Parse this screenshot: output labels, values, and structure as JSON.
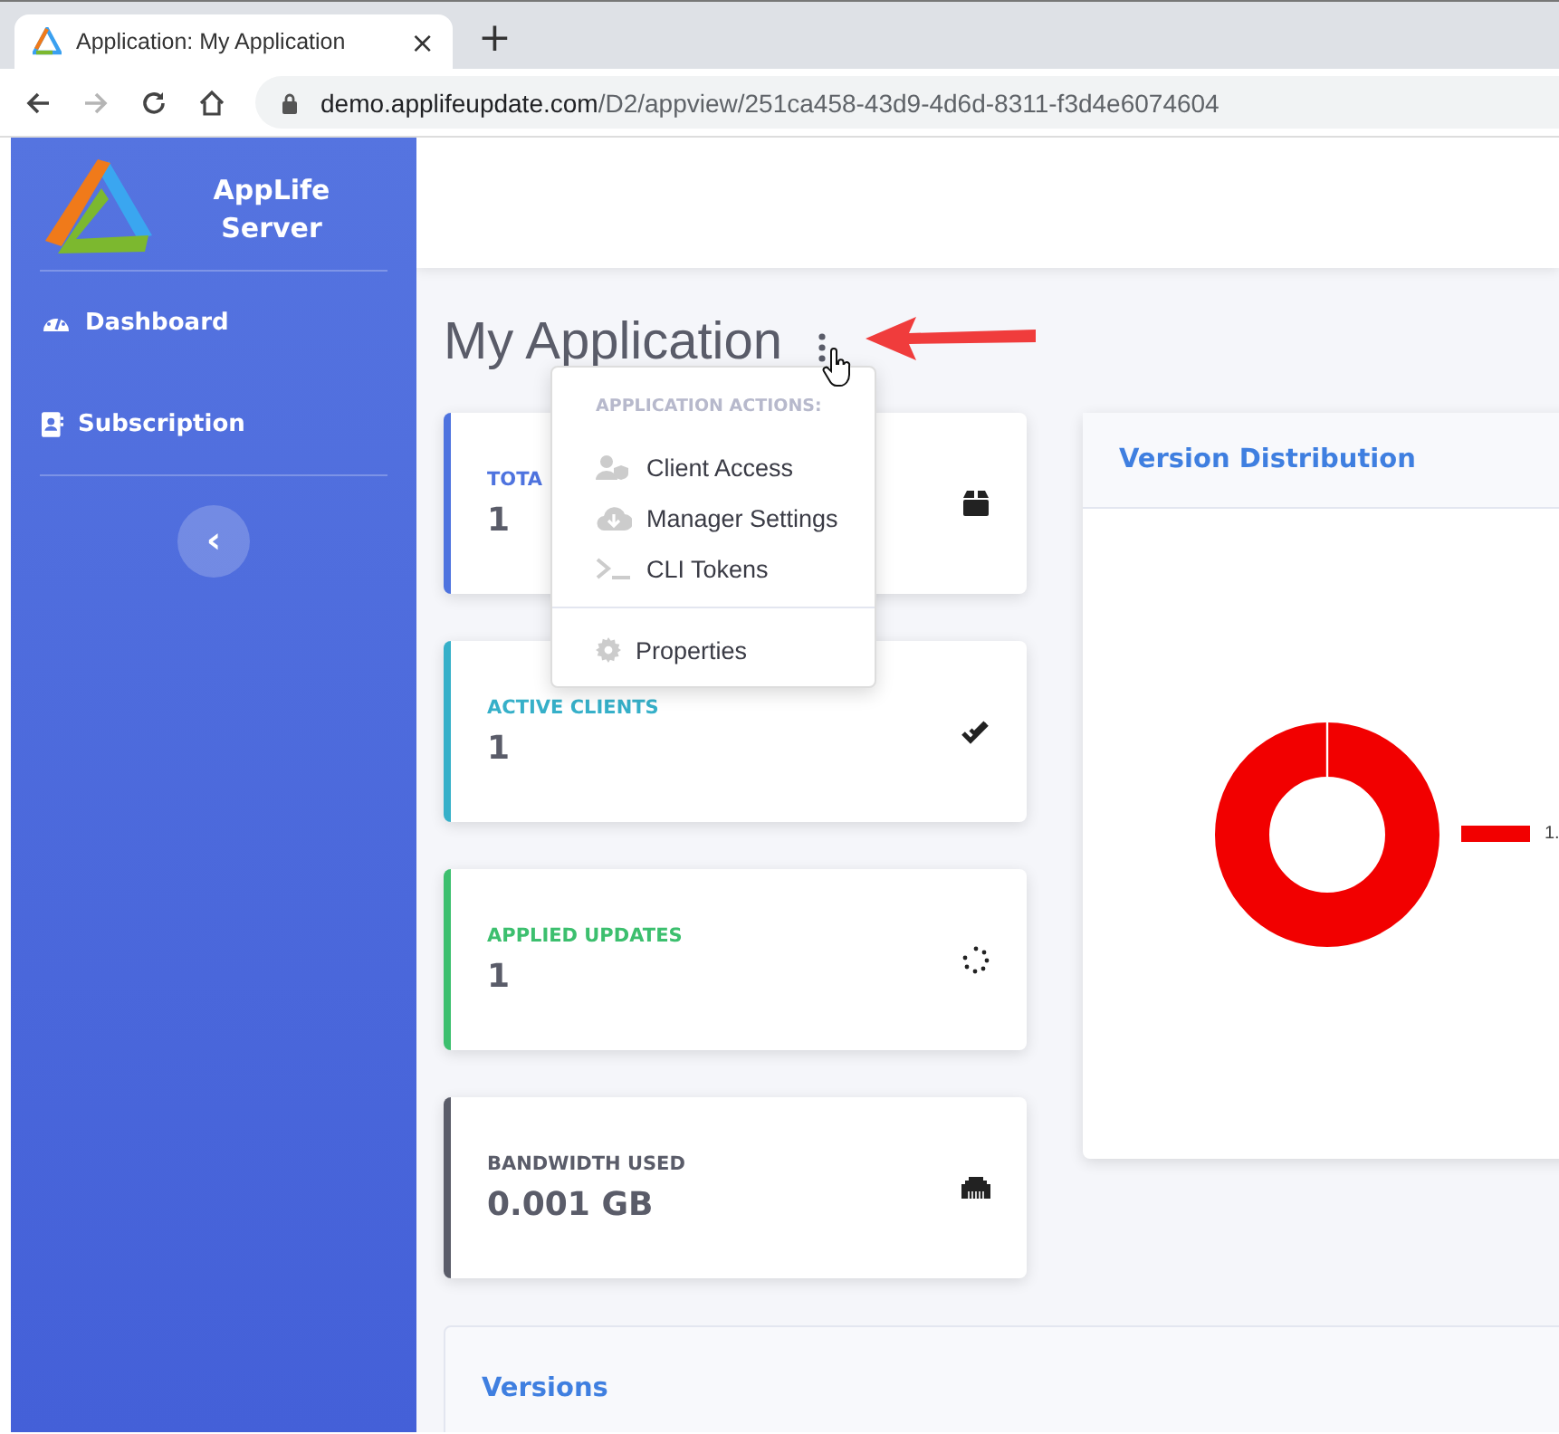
{
  "browser": {
    "tab": {
      "title": "Application: My Application",
      "close": "×"
    },
    "new_tab": "+",
    "forward": {
      "disabled": true
    },
    "url_host": "demo.applifeupdate.com",
    "url_path": "/D2/appview/251ca458-43d9-4d6d-8311-f3d4e6074604"
  },
  "sidebar": {
    "brand": [
      "AppLife",
      "Server"
    ],
    "items": [
      {
        "label": "Dashboard"
      },
      {
        "label": "Subscription"
      }
    ],
    "toggle": "‹"
  },
  "page": {
    "title": "My Application"
  },
  "stats": [
    {
      "label": "TOTA",
      "value": "1",
      "color": "#4e73df"
    },
    {
      "label": "ACTIVE CLIENTS",
      "value": "1",
      "color": "#36b0c9"
    },
    {
      "label": "APPLIED UPDATES",
      "value": "1",
      "color": "#3cbf6e"
    },
    {
      "label": "BANDWIDTH USED",
      "value": "0.001 GB",
      "color": "#5a5c69"
    }
  ],
  "menu": {
    "heading": "APPLICATION ACTIONS:",
    "items": [
      {
        "label": "Client Access"
      },
      {
        "label": "Manager Settings"
      },
      {
        "label": "CLI Tokens"
      }
    ],
    "footer_items": [
      {
        "label": "Properties"
      }
    ]
  },
  "version_distribution": {
    "title": "Version Distribution",
    "legend": [
      {
        "label": "1.",
        "color": "#f20000"
      }
    ]
  },
  "versions": {
    "title": "Versions"
  }
}
